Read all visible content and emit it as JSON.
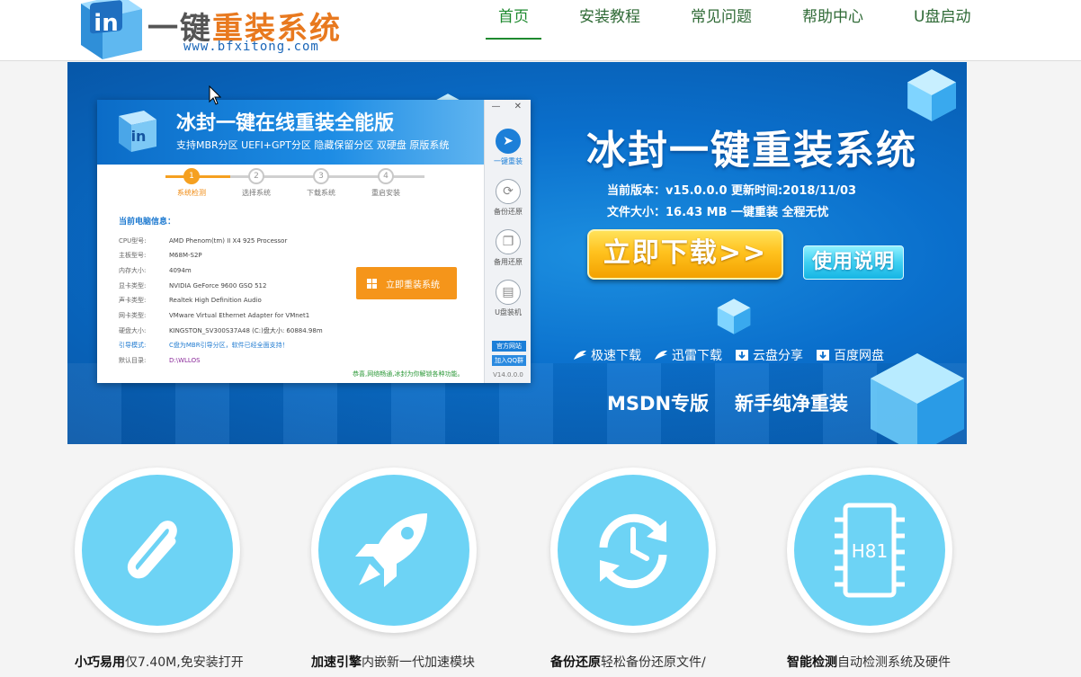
{
  "header": {
    "logo_cube_text": "in",
    "logo_title_part1": "一键",
    "logo_title_part2": "重装系统",
    "logo_url": "www.bfxitong.com",
    "nav": [
      {
        "label": "首页",
        "active": true
      },
      {
        "label": "安装教程",
        "active": false
      },
      {
        "label": "常见问题",
        "active": false
      },
      {
        "label": "帮助中心",
        "active": false
      },
      {
        "label": "U盘启动",
        "active": false
      }
    ]
  },
  "app_window": {
    "logo_text": "in",
    "title": "冰封一键在线重装全能版",
    "subtitle": "支持MBR分区  UEFI+GPT分区  隐藏保留分区  双硬盘  原版系统",
    "win_controls": "— ✕",
    "steps": [
      {
        "num": "1",
        "label": "系统检测",
        "active": true
      },
      {
        "num": "2",
        "label": "选择系统",
        "active": false
      },
      {
        "num": "3",
        "label": "下载系统",
        "active": false
      },
      {
        "num": "4",
        "label": "重启安装",
        "active": false
      }
    ],
    "info_title": "当前电脑信息：",
    "info": [
      {
        "k": "CPU型号:",
        "v": "AMD Phenom(tm) II X4 925 Processor"
      },
      {
        "k": "主板型号:",
        "v": "M68M-S2P"
      },
      {
        "k": "内存大小:",
        "v": "4094m"
      },
      {
        "k": "显卡类型:",
        "v": "NVIDIA GeForce 9600 GSO 512"
      },
      {
        "k": "声卡类型:",
        "v": "Realtek High Definition Audio"
      },
      {
        "k": "网卡类型:",
        "v": "VMware Virtual Ethernet Adapter for VMnet1"
      },
      {
        "k": "硬盘大小:",
        "v": "KINGSTON_SV300S37A48      (C:)盘大小: 60884.98m"
      },
      {
        "k": "引导模式:",
        "v": "C盘为MBR引导分区，软件已经全面支持！"
      },
      {
        "k": "默认目录:",
        "v": "D:\\WLLOS"
      }
    ],
    "reinstall_label": "立即重装系统",
    "footer": "恭喜,网络畅通,冰封为你解锁各种功能。",
    "side": [
      {
        "label": "一键重装",
        "active": true
      },
      {
        "label": "备份还原",
        "active": false
      },
      {
        "label": "备用还原",
        "active": false
      },
      {
        "label": "U盘装机",
        "active": false
      }
    ],
    "tag_official": "官方网站",
    "tag_qq": "加入QQ群",
    "version": "V14.0.0.0"
  },
  "banner": {
    "title": "冰封一键重装系统",
    "version_line": "当前版本：v15.0.0.0 更新时间:2018/11/03",
    "size_line": "文件大小：16.43 MB 一键重装 全程无忧",
    "download_label": "立即下载>>",
    "guide_label": "使用说明",
    "links": [
      {
        "label": "极速下载",
        "icon": "fast-download-icon"
      },
      {
        "label": "迅雷下载",
        "icon": "thunder-download-icon"
      },
      {
        "label": "云盘分享",
        "icon": "cloud-share-icon"
      },
      {
        "label": "百度网盘",
        "icon": "baidu-disk-icon"
      }
    ],
    "edition_1": "MSDN专版",
    "edition_2": "新手纯净重装"
  },
  "features": [
    {
      "icon": "paperclip-icon",
      "bold": "小巧易用",
      "text": "仅7.40M,免安装打开"
    },
    {
      "icon": "rocket-icon",
      "bold": "加速引擎",
      "text": "内嵌新一代加速模块"
    },
    {
      "icon": "backup-restore-icon",
      "bold": "备份还原",
      "text": "轻松备份还原文件/"
    },
    {
      "icon": "chip-icon",
      "bold": "智能检测",
      "text": "自动检测系统及硬件",
      "chip_label": "H81"
    }
  ],
  "colors": {
    "nav_active": "#1e8a2f",
    "banner_blue": "#0a6fcc",
    "feature_blue": "#6dd3f5",
    "download_orange": "#ffc21e"
  }
}
